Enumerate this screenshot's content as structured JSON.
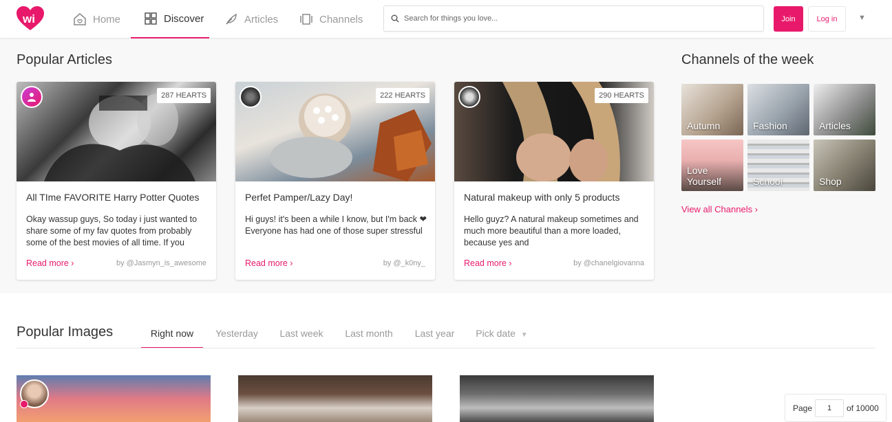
{
  "nav": {
    "tabs": [
      {
        "label": "Home",
        "icon": "home-icon"
      },
      {
        "label": "Discover",
        "icon": "grid-icon"
      },
      {
        "label": "Articles",
        "icon": "feather-icon"
      },
      {
        "label": "Channels",
        "icon": "channels-icon"
      }
    ],
    "active_tab": "Discover",
    "search_placeholder": "Search for things you love...",
    "join_label": "Join",
    "login_label": "Log in",
    "brand_color": "#e8196b"
  },
  "popular_articles": {
    "heading": "Popular Articles",
    "cards": [
      {
        "hearts": "287 HEARTS",
        "title": "All TIme FAVORITE Harry Potter Quotes",
        "excerpt": "Okay wassup guys, So today i just wanted to share some of my fav quotes from probably some of the best movies of all time. If you",
        "read_more": "Read more ›",
        "author": "by @Jasmyn_is_awesome"
      },
      {
        "hearts": "222 HEARTS",
        "title": "Perfet Pamper/Lazy Day!",
        "excerpt": "Hi guys! it's been a while I know, but I'm back ❤ Everyone has had one of those super stressful",
        "read_more": "Read more ›",
        "author": "by @_k0ny_"
      },
      {
        "hearts": "290 HEARTS",
        "title": "Natural makeup with only 5 products",
        "excerpt": "Hello guyz? A natural makeup sometimes and much more beautiful than a more loaded, because yes and",
        "read_more": "Read more ›",
        "author": "by @chanelgiovanna"
      }
    ]
  },
  "channels": {
    "heading": "Channels of the week",
    "items": [
      "Autumn",
      "Fashion",
      "Articles",
      "Love Yourself",
      "School",
      "Shop"
    ],
    "view_all": "View all Channels ›"
  },
  "popular_images": {
    "heading": "Popular Images",
    "tabs": [
      "Right now",
      "Yesterday",
      "Last week",
      "Last month",
      "Last year",
      "Pick date"
    ],
    "active_tab": "Right now"
  },
  "pager": {
    "page_label": "Page",
    "page_value": "1",
    "of_label": "of 10000"
  }
}
